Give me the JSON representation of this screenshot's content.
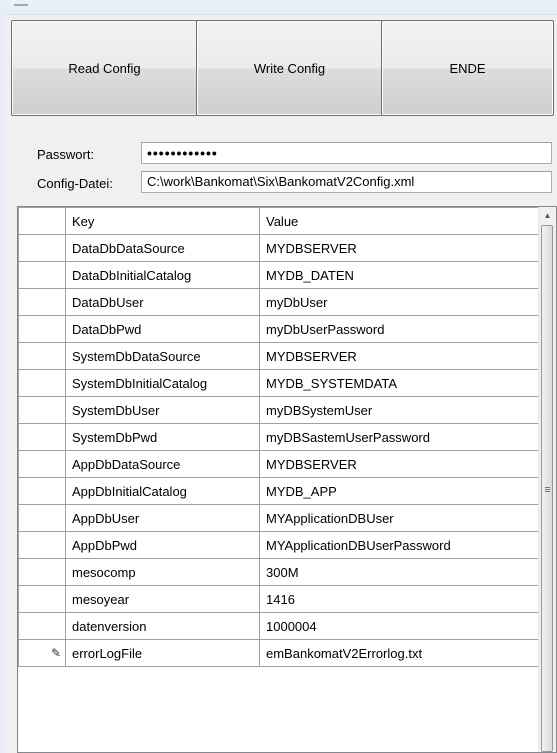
{
  "toolbar": {
    "read_label": "Read Config",
    "write_label": "Write Config",
    "end_label": "ENDE"
  },
  "form": {
    "password_label": "Passwort:",
    "password_value": "••••••••••••",
    "config_label": "Config-Datei:",
    "config_value": "C:\\work\\Bankomat\\Six\\BankomatV2Config.xml"
  },
  "grid": {
    "columns": [
      "Key",
      "Value"
    ],
    "rows": [
      [
        "DataDbDataSource",
        "MYDBSERVER"
      ],
      [
        "DataDbInitialCatalog",
        "MYDB_DATEN"
      ],
      [
        "DataDbUser",
        "myDbUser"
      ],
      [
        "DataDbPwd",
        "myDbUserPassword"
      ],
      [
        "SystemDbDataSource",
        "MYDBSERVER"
      ],
      [
        "SystemDbInitialCatalog",
        "MYDB_SYSTEMDATA"
      ],
      [
        "SystemDbUser",
        "myDBSystemUser"
      ],
      [
        "SystemDbPwd",
        "myDBSastemUserPassword"
      ],
      [
        "AppDbDataSource",
        "MYDBSERVER"
      ],
      [
        "AppDbInitialCatalog",
        "MYDB_APP"
      ],
      [
        "AppDbUser",
        "MYApplicationDBUser"
      ],
      [
        "AppDbPwd",
        "MYApplicationDBUserPassword"
      ],
      [
        "mesocomp",
        "300M"
      ],
      [
        "mesoyear",
        "1416"
      ],
      [
        "datenversion",
        "1000004"
      ],
      [
        "errorLogFile",
        "emBankomatV2Errorlog.txt"
      ]
    ],
    "edit_row_index": 15,
    "edit_icon": "pencil-icon"
  }
}
